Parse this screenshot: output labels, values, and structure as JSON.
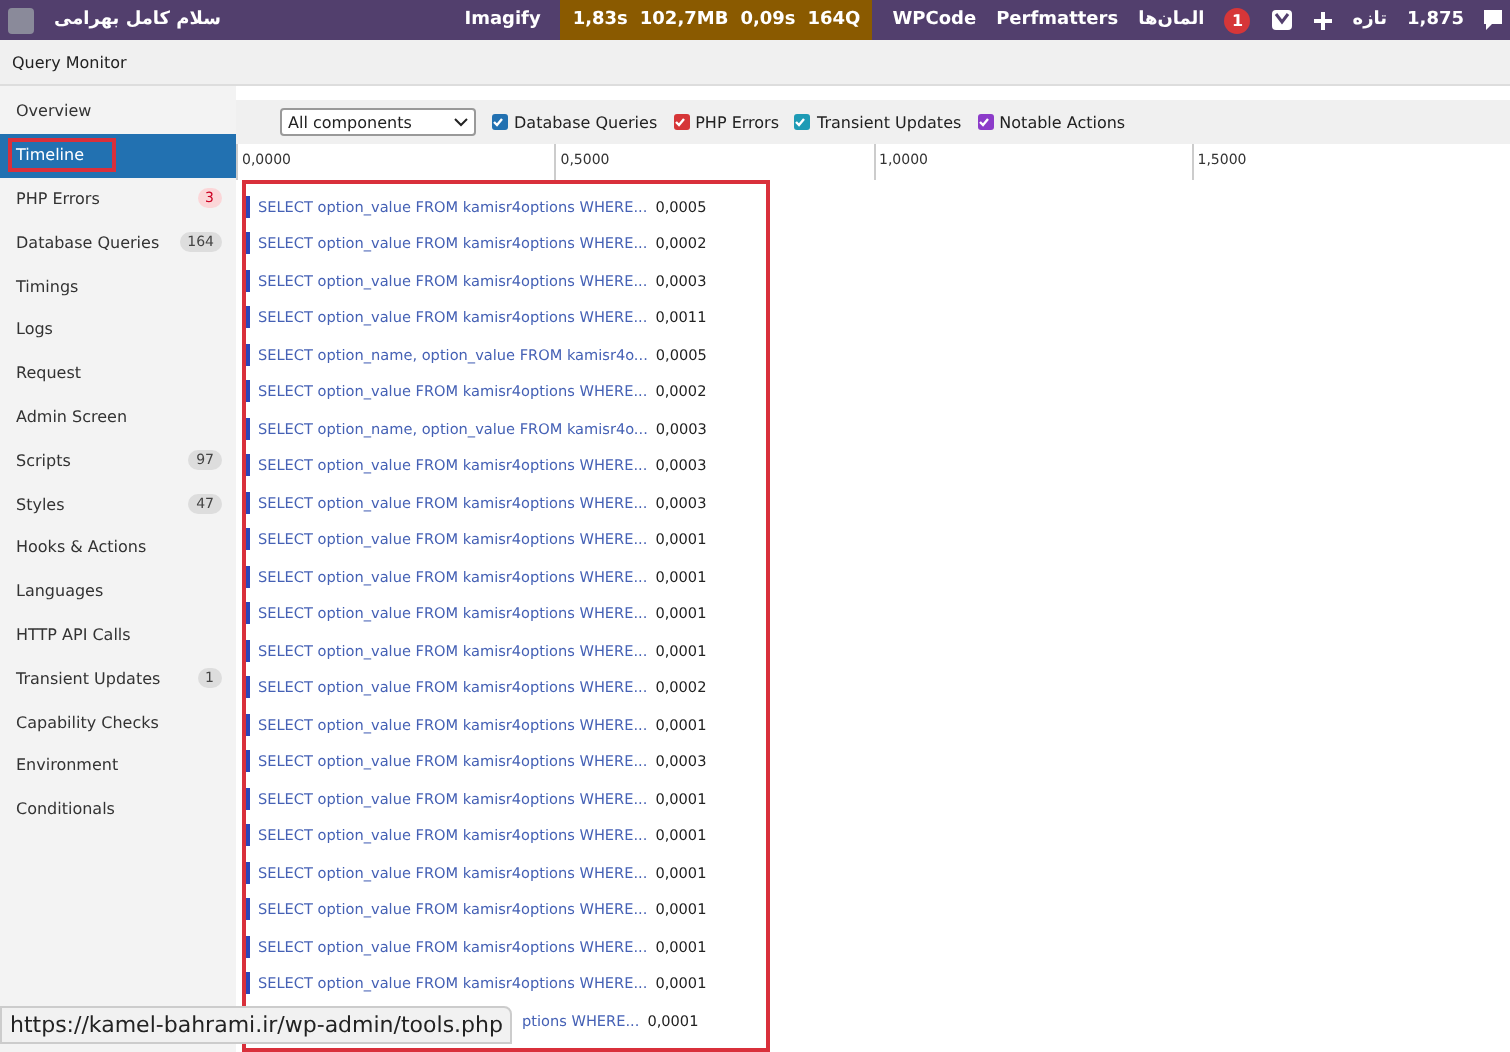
{
  "admin_bar": {
    "greeting": "سلام کامل بهرامی",
    "imagify": "Imagify",
    "qm_stats": [
      "1,83s",
      "102,7MB",
      "0,09s",
      "164Q"
    ],
    "wpcode": "WPCode",
    "perfmatters": "Perfmatters",
    "elements": "المان‌ها",
    "notifications": "1",
    "new": "تازه",
    "comments": "1,875"
  },
  "panel_title": "Query Monitor",
  "sidebar": {
    "items": [
      {
        "label": "Overview",
        "selected": false
      },
      {
        "label": "Timeline",
        "selected": true
      },
      {
        "label": "PHP Errors",
        "selected": false,
        "count": "3",
        "kind": "alert"
      },
      {
        "label": "Database Queries",
        "selected": false,
        "count": "164",
        "kind": "plain"
      },
      {
        "label": "Timings",
        "selected": false
      },
      {
        "label": "Logs",
        "selected": false
      },
      {
        "label": "Request",
        "selected": false
      },
      {
        "label": "Admin Screen",
        "selected": false
      },
      {
        "label": "Scripts",
        "selected": false,
        "count": "97",
        "kind": "plain"
      },
      {
        "label": "Styles",
        "selected": false,
        "count": "47",
        "kind": "plain"
      },
      {
        "label": "Hooks & Actions",
        "selected": false
      },
      {
        "label": "Languages",
        "selected": false
      },
      {
        "label": "HTTP API Calls",
        "selected": false
      },
      {
        "label": "Transient Updates",
        "selected": false,
        "count": "1",
        "kind": "plain"
      },
      {
        "label": "Capability Checks",
        "selected": false
      },
      {
        "label": "Environment",
        "selected": false
      },
      {
        "label": "Conditionals",
        "selected": false
      }
    ]
  },
  "filters": {
    "component": "All components",
    "toggles": [
      {
        "label": "Database Queries",
        "checked": true,
        "color": "#2271b1"
      },
      {
        "label": "PHP Errors",
        "checked": true,
        "color": "#d63638"
      },
      {
        "label": "Transient Updates",
        "checked": true,
        "color": "#1e9bb5"
      },
      {
        "label": "Notable Actions",
        "checked": true,
        "color": "#8c3bc9"
      }
    ]
  },
  "axis_ticks": [
    "0,0000",
    "0,5000",
    "1,0000",
    "1,5000"
  ],
  "rows": [
    {
      "query": "SELECT option_value FROM kamisr4options WHERE...",
      "time": "0,0005"
    },
    {
      "query": "SELECT option_value FROM kamisr4options WHERE...",
      "time": "0,0002"
    },
    {
      "query": "SELECT option_value FROM kamisr4options WHERE...",
      "time": "0,0003"
    },
    {
      "query": "SELECT option_value FROM kamisr4options WHERE...",
      "time": "0,0011"
    },
    {
      "query": "SELECT option_name, option_value FROM kamisr4o...",
      "time": "0,0005"
    },
    {
      "query": "SELECT option_value FROM kamisr4options WHERE...",
      "time": "0,0002"
    },
    {
      "query": "SELECT option_name, option_value FROM kamisr4o...",
      "time": "0,0003"
    },
    {
      "query": "SELECT option_value FROM kamisr4options WHERE...",
      "time": "0,0003"
    },
    {
      "query": "SELECT option_value FROM kamisr4options WHERE...",
      "time": "0,0003"
    },
    {
      "query": "SELECT option_value FROM kamisr4options WHERE...",
      "time": "0,0001"
    },
    {
      "query": "SELECT option_value FROM kamisr4options WHERE...",
      "time": "0,0001"
    },
    {
      "query": "SELECT option_value FROM kamisr4options WHERE...",
      "time": "0,0001"
    },
    {
      "query": "SELECT option_value FROM kamisr4options WHERE...",
      "time": "0,0001"
    },
    {
      "query": "SELECT option_value FROM kamisr4options WHERE...",
      "time": "0,0002"
    },
    {
      "query": "SELECT option_value FROM kamisr4options WHERE...",
      "time": "0,0001"
    },
    {
      "query": "SELECT option_value FROM kamisr4options WHERE...",
      "time": "0,0003"
    },
    {
      "query": "SELECT option_value FROM kamisr4options WHERE...",
      "time": "0,0001"
    },
    {
      "query": "SELECT option_value FROM kamisr4options WHERE...",
      "time": "0,0001"
    },
    {
      "query": "SELECT option_value FROM kamisr4options WHERE...",
      "time": "0,0001"
    },
    {
      "query": "SELECT option_value FROM kamisr4options WHERE...",
      "time": "0,0001"
    },
    {
      "query": "SELECT option_value FROM kamisr4options WHERE...",
      "time": "0,0001"
    },
    {
      "query": "SELECT option_value FROM kamisr4options WHERE...",
      "time": "0,0001"
    },
    {
      "query": "ptions WHERE...",
      "time": "0,0001",
      "kind": "covered"
    }
  ],
  "status_url": "https://kamel-bahrami.ir/wp-admin/tools.php"
}
